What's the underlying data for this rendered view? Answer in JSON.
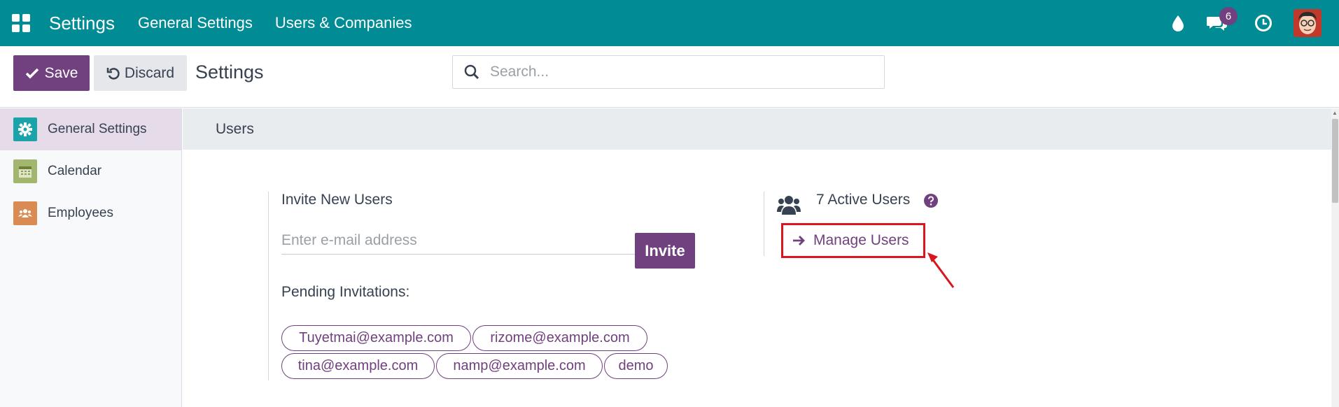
{
  "navbar": {
    "brand": "Settings",
    "links": [
      "General Settings",
      "Users & Companies"
    ],
    "messages_badge": "6",
    "icons": [
      "apps-icon",
      "drop-icon",
      "chat-icon",
      "clock-icon",
      "avatar"
    ],
    "bg_color": "#018b94"
  },
  "control": {
    "save_label": "Save",
    "discard_label": "Discard",
    "title": "Settings",
    "search_placeholder": "Search..."
  },
  "sidebar": {
    "items": [
      {
        "label": "General Settings",
        "icon": "gear-icon",
        "active": true
      },
      {
        "label": "Calendar",
        "icon": "calendar-icon",
        "active": false
      },
      {
        "label": "Employees",
        "icon": "employees-icon",
        "active": false
      }
    ]
  },
  "main": {
    "section_title": "Users",
    "invite": {
      "title": "Invite New Users",
      "email_placeholder": "Enter e-mail address",
      "invite_label": "Invite",
      "pending_title": "Pending Invitations:",
      "pending": [
        "Tuyetmai@example.com",
        "rizome@example.com",
        "tina@example.com",
        "namp@example.com",
        "demo"
      ]
    },
    "users": {
      "active_users": "7 Active Users",
      "manage_label": "Manage Users"
    }
  },
  "colors": {
    "accent": "#71407f",
    "highlight": "#d9161c"
  }
}
